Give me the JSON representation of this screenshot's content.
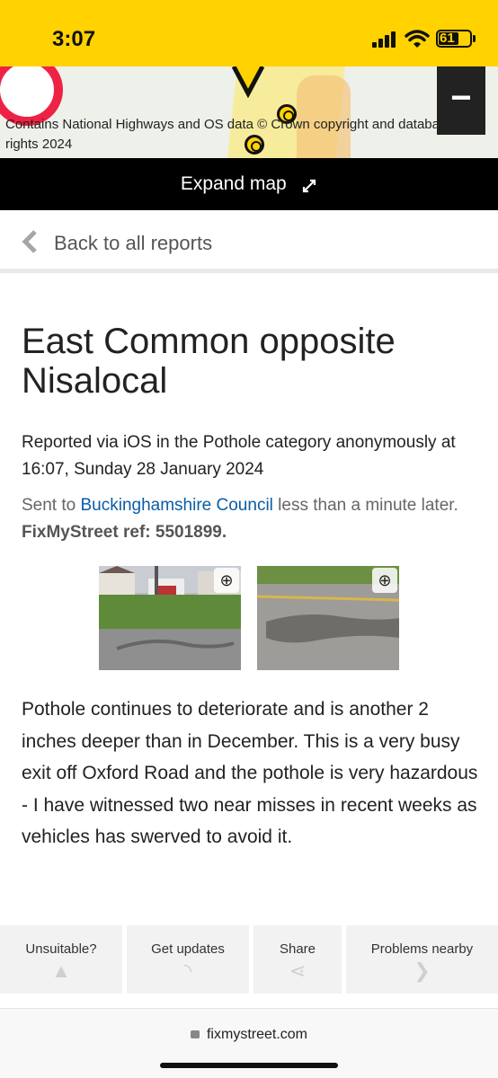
{
  "status_bar": {
    "time": "3:07",
    "battery": "61",
    "background": "#ffd200"
  },
  "map": {
    "attribution": "Contains National Highways and OS data © Crown copyright and database rights 2024",
    "zoom_out_label": "−",
    "expand_label": "Expand map",
    "expand_icon": "expand-arrows-icon"
  },
  "nav": {
    "back_label": "Back to all reports",
    "back_icon": "chevron-left-icon"
  },
  "report": {
    "title": "East Common opposite Nisalocal",
    "meta": "Reported via iOS in the Pothole category anonymously at 16:07, Sunday 28 January 2024",
    "sent_prefix": "Sent to ",
    "council": "Buckinghamshire Council",
    "sent_suffix": " less than a minute later. ",
    "ref": "FixMyStreet ref: 5501899.",
    "description": "Pothole continues to deteriorate and is another 2 inches deeper than in December. This is a very busy exit off Oxford Road and the pothole is very hazardous - I have witnessed two near misses in recent weeks as vehicles has swerved to avoid it.",
    "link_color": "#0b5ca5"
  },
  "actions": [
    {
      "label": "Unsuitable?",
      "icon": "warning-icon"
    },
    {
      "label": "Get updates",
      "icon": "rss-icon"
    },
    {
      "label": "Share",
      "icon": "share-icon"
    },
    {
      "label": "Problems nearby",
      "icon": "chevron-right-icon"
    }
  ],
  "browser": {
    "url": "fixmystreet.com"
  }
}
